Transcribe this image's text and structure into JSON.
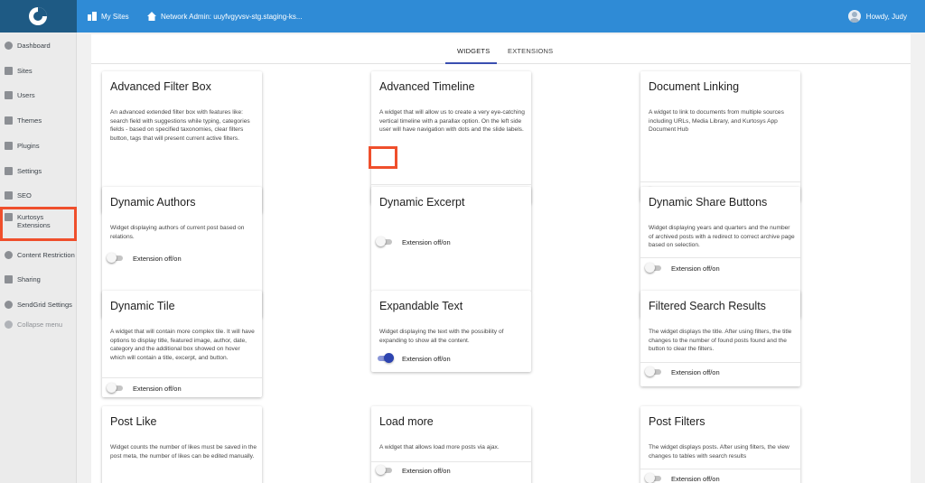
{
  "topbar": {
    "my_sites": "My Sites",
    "network_admin": "Network Admin: uuyfvgyvsv-stg.staging-ks...",
    "howdy": "Howdy, Judy"
  },
  "sidebar": {
    "items": [
      {
        "label": "Dashboard",
        "icon": "dashboard-icon"
      },
      {
        "label": "Sites",
        "icon": "sites-icon"
      },
      {
        "label": "Users",
        "icon": "users-icon"
      },
      {
        "label": "Themes",
        "icon": "themes-icon"
      },
      {
        "label": "Plugins",
        "icon": "plugins-icon"
      },
      {
        "label": "Settings",
        "icon": "settings-icon"
      },
      {
        "label": "SEO",
        "icon": "seo-icon"
      },
      {
        "label": "Kurtosys",
        "label2": "Extensions",
        "icon": "extensions-icon"
      },
      {
        "label": "Content Restriction",
        "icon": "gear-icon"
      },
      {
        "label": "Sharing",
        "icon": "sharing-icon"
      },
      {
        "label": "SendGrid Settings",
        "icon": "gear-icon"
      },
      {
        "label": "Collapse menu",
        "icon": "collapse-icon"
      }
    ]
  },
  "tabs": [
    {
      "label": "WIDGETS",
      "active": true
    },
    {
      "label": "EXTENSIONS",
      "active": false
    }
  ],
  "toggle_label": "Extension off/on",
  "colors": {
    "topbar": "#2f8bd6",
    "logo_bg": "#1e5a84",
    "highlight": "#ef4f2c",
    "toggle_on": "#2d44b0"
  },
  "cards": [
    {
      "title": "Advanced Filter Box",
      "desc": "An advanced extended filter box with features like: search field with suggestions while typing, categories fields - based on specified taxonomies, clear filters button, tags that will present current active filters.",
      "on": false
    },
    {
      "title": "Advanced Timeline",
      "desc": "A widget that will allow us to create a very eye-catching vertical timeline with a parallax option. On the left side user will have navigation with dots and the slide labels.",
      "on": true
    },
    {
      "title": "Document Linking",
      "desc": "A widget to link to documents from multiple sources including URLs, Media Library, and Kurtosys App Document Hub",
      "on": false
    },
    {
      "title": "Dynamic Authors",
      "desc": "Widget displaying authors of current post based on relations.",
      "on": false
    },
    {
      "title": "Dynamic Excerpt",
      "desc": "",
      "on": false
    },
    {
      "title": "Dynamic Share Buttons",
      "desc": "Widget displaying years and quarters and the number of archived posts with a redirect to correct archive page based on selection.",
      "on": false
    },
    {
      "title": "Dynamic Tile",
      "desc": "A widget that will contain more complex tile. It will have options to display title, featured image, author, date, category and the additional box showed on hover which will contain a title, excerpt, and button.",
      "on": false
    },
    {
      "title": "Expandable Text",
      "desc": "Widget displaying the text with the possibility of expanding to show all the content.",
      "on": true
    },
    {
      "title": "Filtered Search Results",
      "desc": "The widget displays the title. After using filters, the title changes to the number of found posts found and the button to clear the filters.",
      "on": false
    },
    {
      "title": "Post Like",
      "desc": "Widget counts the number of likes must be saved in the post meta, the number of likes can be edited manually.",
      "on": false
    },
    {
      "title": "Load more",
      "desc": "A widget that allows load more posts via ajax.",
      "on": false
    },
    {
      "title": "Post Filters",
      "desc": "The widget displays posts. After using filters, the view changes to tables with search results",
      "on": false
    }
  ]
}
